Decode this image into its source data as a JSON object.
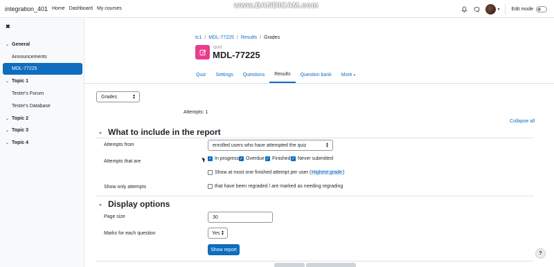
{
  "navbar": {
    "site_name": "integration_401",
    "links": [
      "Home",
      "Dashboard",
      "My courses"
    ],
    "watermark": "www.BANDICAM.com",
    "edit_mode_label": "Edit mode"
  },
  "drawer": {
    "sections": [
      {
        "title": "General",
        "items": [
          "Announcements",
          "MDL-77225"
        ]
      },
      {
        "title": "Topic 1",
        "items": [
          "Tester's Forum",
          "Tester's Database"
        ]
      },
      {
        "title": "Topic 2",
        "items": []
      },
      {
        "title": "Topic 3",
        "items": []
      },
      {
        "title": "Topic 4",
        "items": []
      }
    ],
    "active_item": "MDL-77225"
  },
  "breadcrumb": [
    "tc1",
    "MDL-77225",
    "Results",
    "Grades"
  ],
  "header": {
    "kind": "QUIZ",
    "title": "MDL-77225"
  },
  "tabs": [
    "Quiz",
    "Settings",
    "Questions",
    "Results",
    "Question bank",
    "More"
  ],
  "active_tab": "Results",
  "report_select": "Grades",
  "attempts_text": "Attempts: 1",
  "collapse_all": "Collapse all",
  "include_section": {
    "heading": "What to include in the report",
    "attempts_from_label": "Attempts from",
    "attempts_from_value": "enrolled users who have attempted the quiz",
    "attempts_that_are_label": "Attempts that are",
    "states": [
      {
        "label": "In progress",
        "checked": true
      },
      {
        "label": "Overdue",
        "checked": true
      },
      {
        "label": "Finished",
        "checked": true
      },
      {
        "label": "Never submitted",
        "checked": true
      }
    ],
    "one_attempt_label": "Show at most one finished attempt per user (",
    "one_attempt_highlight": "Highest grade",
    "one_attempt_suffix": ")",
    "only_regraded_label": "Show only attempts",
    "only_regraded_text": "that have been regraded / are marked as needing regrading"
  },
  "display_section": {
    "heading": "Display options",
    "page_size_label": "Page size",
    "page_size_value": "30",
    "marks_label": "Marks for each question",
    "marks_value": "Yes",
    "submit_label": "Show report"
  },
  "help_label": "?"
}
